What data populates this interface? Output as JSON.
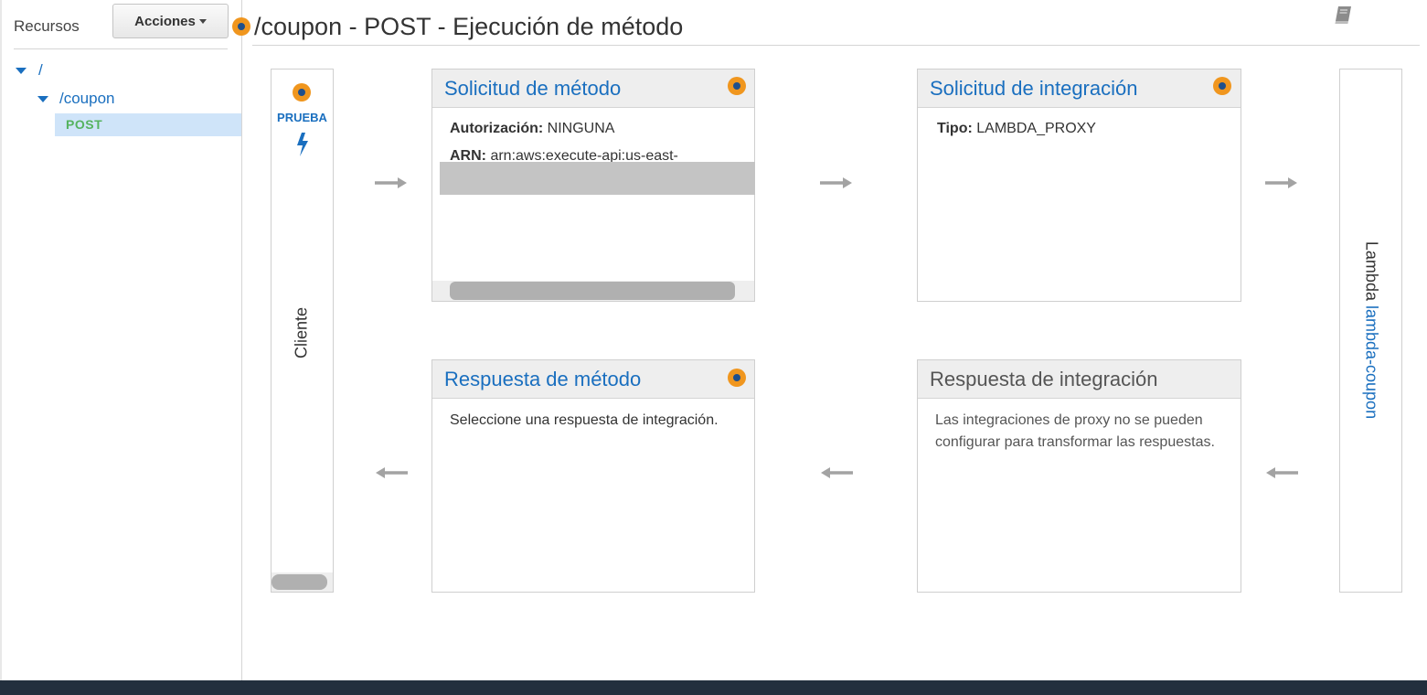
{
  "sidebar": {
    "title": "Recursos",
    "actions_label": "Acciones",
    "tree": {
      "root": "/",
      "resource": "/coupon",
      "method": "POST"
    }
  },
  "header": {
    "title": "/coupon - POST - Ejecución de método"
  },
  "client": {
    "test_label": "PRUEBA",
    "label": "Cliente"
  },
  "method_request": {
    "title": "Solicitud de método",
    "auth_key": "Autorización:",
    "auth_value": "NINGUNA",
    "arn_key": "ARN:",
    "arn_value": "arn:aws:execute-api:us-east-"
  },
  "integration_request": {
    "title": "Solicitud de integración",
    "type_key": "Tipo:",
    "type_value": "LAMBDA_PROXY"
  },
  "method_response": {
    "title": "Respuesta de método",
    "body": "Seleccione una respuesta de integración."
  },
  "integration_response": {
    "title": "Respuesta de integración",
    "body": "Las integraciones de proxy no se pueden configurar para transformar las respuestas."
  },
  "lambda": {
    "label": "Lambda",
    "function": "lambda-coupon"
  },
  "colors": {
    "accent": "#1a6fbf",
    "orange": "#f0961e",
    "post_green": "#55b35f",
    "footer": "#232f3e"
  },
  "icons": [
    "help-dot-icon",
    "book-icon",
    "bolt-icon",
    "arrow-right-icon",
    "arrow-left-icon",
    "caret-down-icon"
  ]
}
